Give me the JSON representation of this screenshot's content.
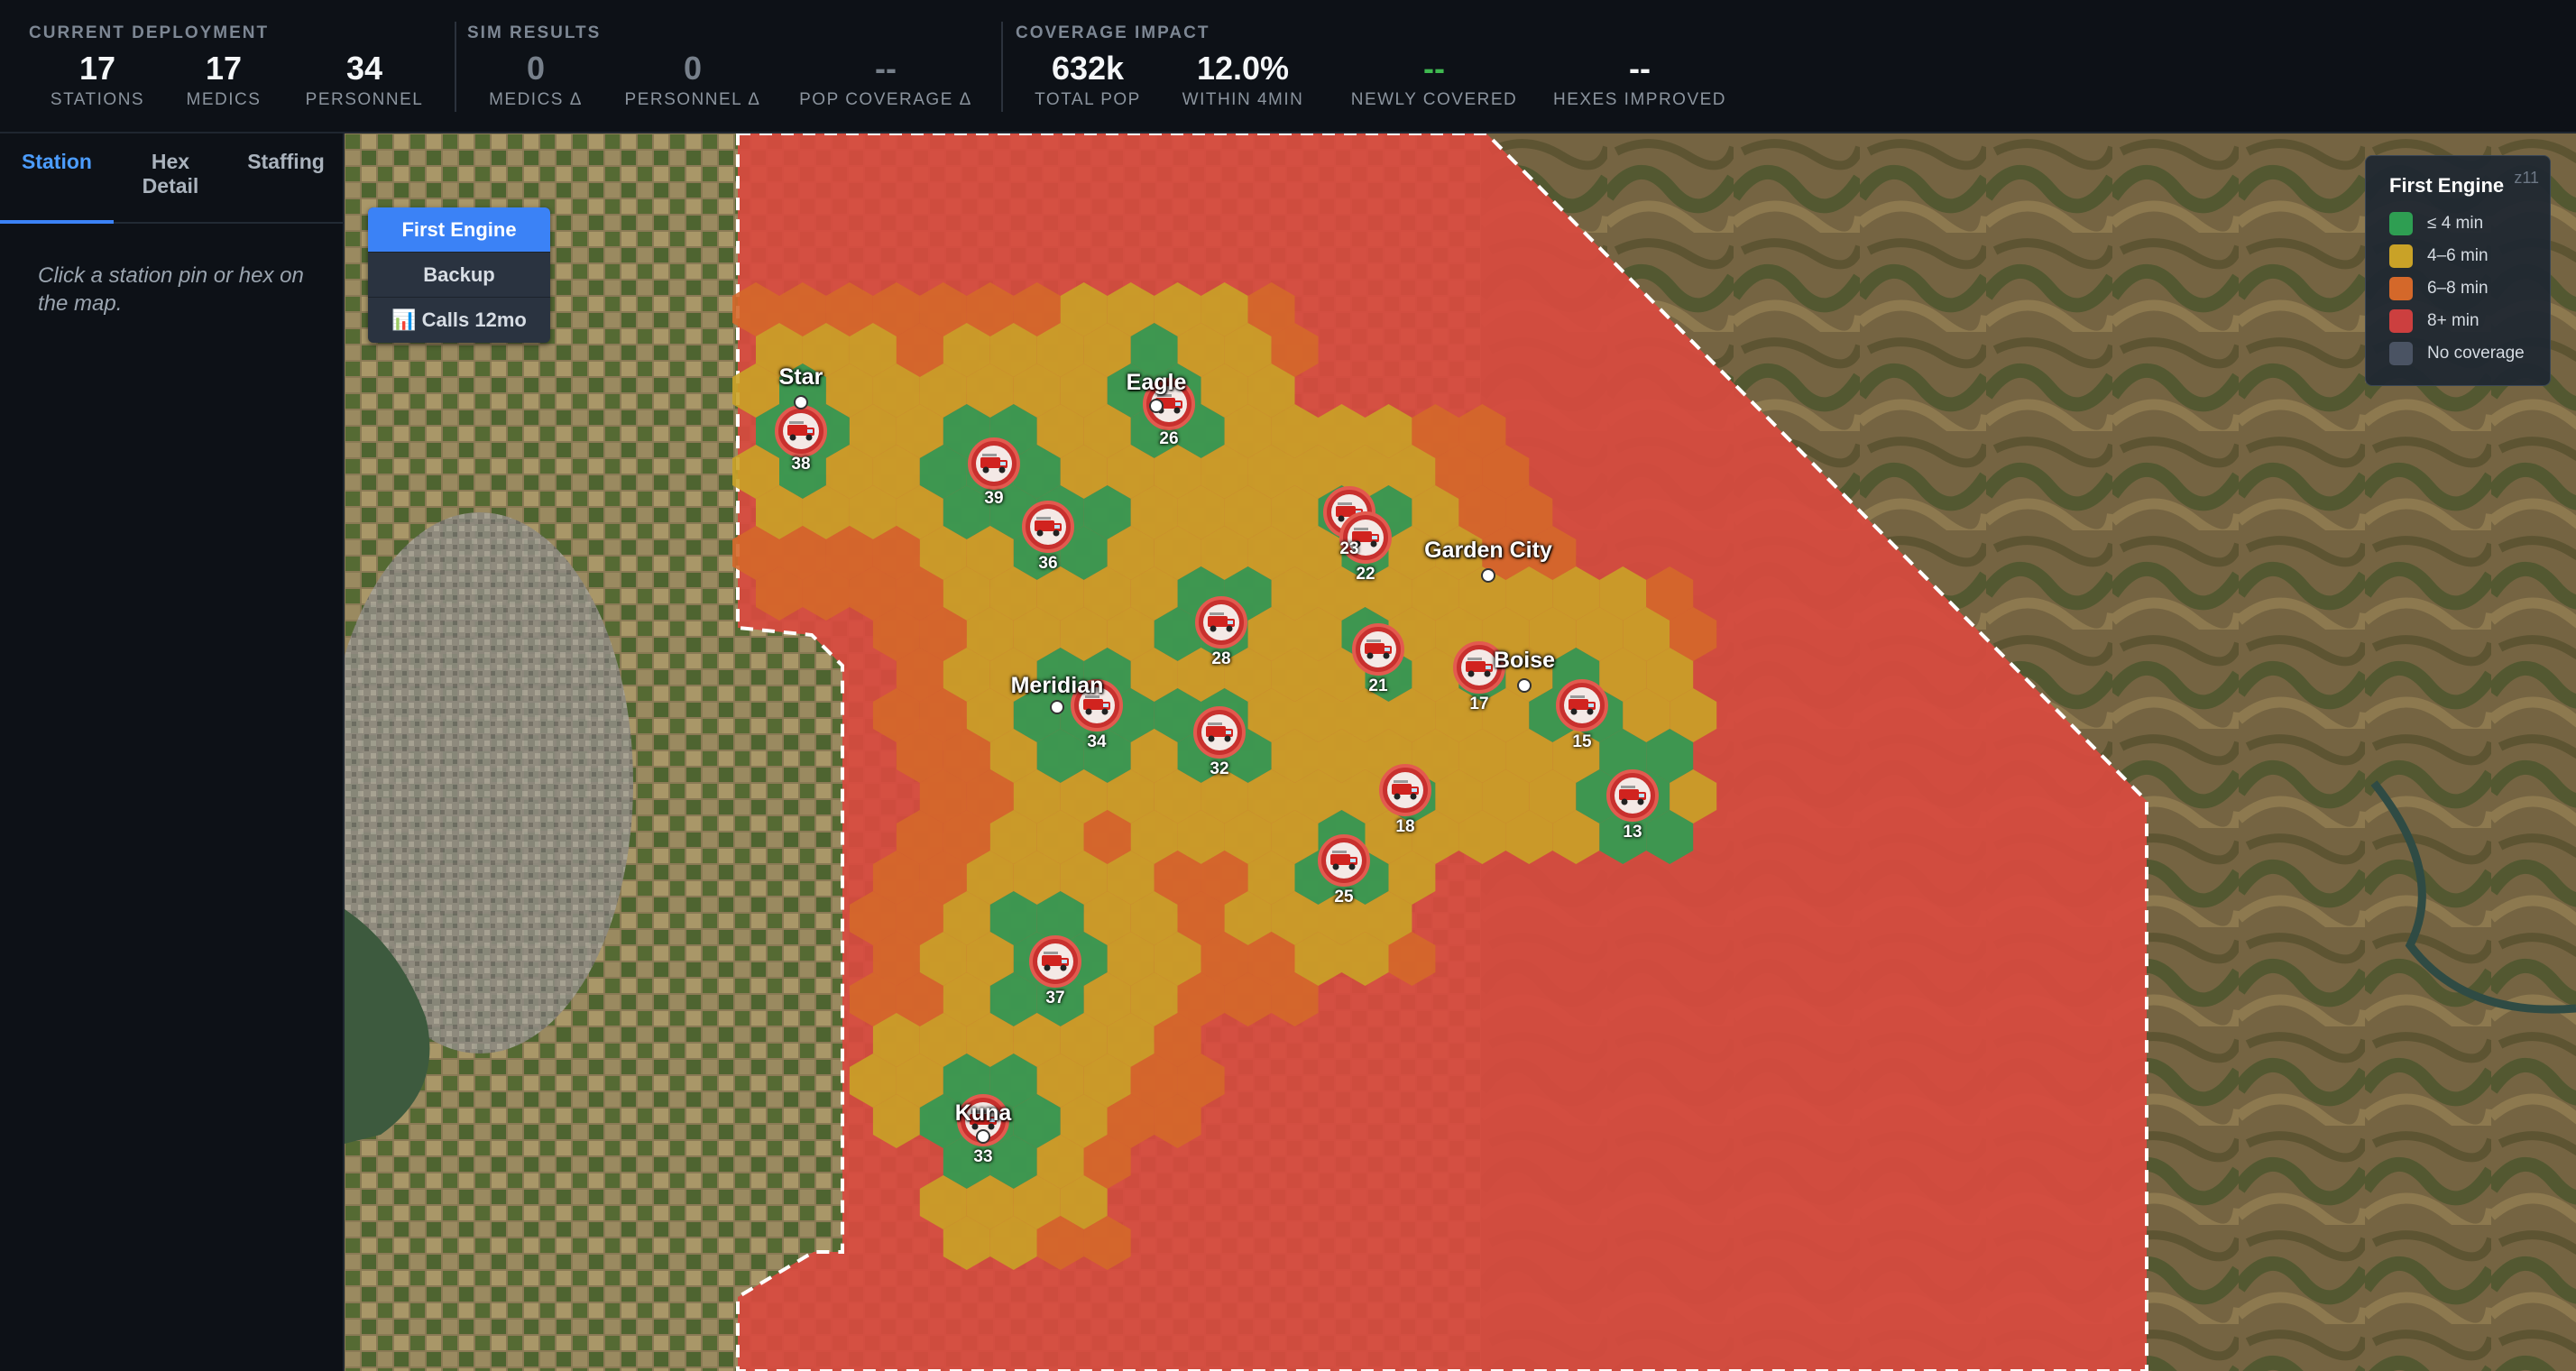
{
  "header": {
    "current_deployment": {
      "title": "CURRENT DEPLOYMENT",
      "stats": [
        {
          "value": "17",
          "label": "STATIONS"
        },
        {
          "value": "17",
          "label": "MEDICS"
        },
        {
          "value": "34",
          "label": "PERSONNEL"
        }
      ]
    },
    "sim_results": {
      "title": "SIM RESULTS",
      "stats": [
        {
          "value": "0",
          "label": "MEDICS Δ"
        },
        {
          "value": "0",
          "label": "PERSONNEL Δ"
        },
        {
          "value": "--",
          "label": "POP COVERAGE Δ"
        }
      ]
    },
    "coverage_impact": {
      "title": "COVERAGE IMPACT",
      "stats": [
        {
          "value": "632k",
          "label": "TOTAL POP"
        },
        {
          "value": "12.0%",
          "label": "WITHIN 4MIN"
        },
        {
          "value": "--",
          "label": "NEWLY COVERED"
        },
        {
          "value": "--",
          "label": "HEXES IMPROVED"
        }
      ]
    }
  },
  "sidebar": {
    "tabs": [
      {
        "label": "Station",
        "active": true
      },
      {
        "label": "Hex\nDetail",
        "active": false
      },
      {
        "label": "Staffing",
        "active": false
      }
    ],
    "hint": "Click a station pin or hex on the map."
  },
  "map": {
    "layers": [
      {
        "label": "First Engine",
        "active": true
      },
      {
        "label": "Backup",
        "active": false
      },
      {
        "label": "📊 Calls 12mo",
        "active": false
      }
    ],
    "legend": {
      "title": "First Engine",
      "zoom": "z11",
      "items": [
        {
          "label": "≤ 4 min",
          "color": "#2e9e52"
        },
        {
          "label": "4–6 min",
          "color": "#c9a227"
        },
        {
          "label": "6–8 min",
          "color": "#d4682a"
        },
        {
          "label": "8+ min",
          "color": "#cc3f3f"
        },
        {
          "label": "No coverage",
          "color": "#4a5363"
        }
      ]
    },
    "cities": [
      "Star",
      "Eagle",
      "Garden City",
      "Meridian",
      "Boise",
      "Kuna"
    ],
    "stations": [
      "38",
      "39",
      "26",
      "36",
      "23",
      "22",
      "28",
      "21",
      "17",
      "15",
      "34",
      "32",
      "18",
      "13",
      "25",
      "37",
      "33"
    ],
    "station_icon": "fire-engine-icon"
  }
}
